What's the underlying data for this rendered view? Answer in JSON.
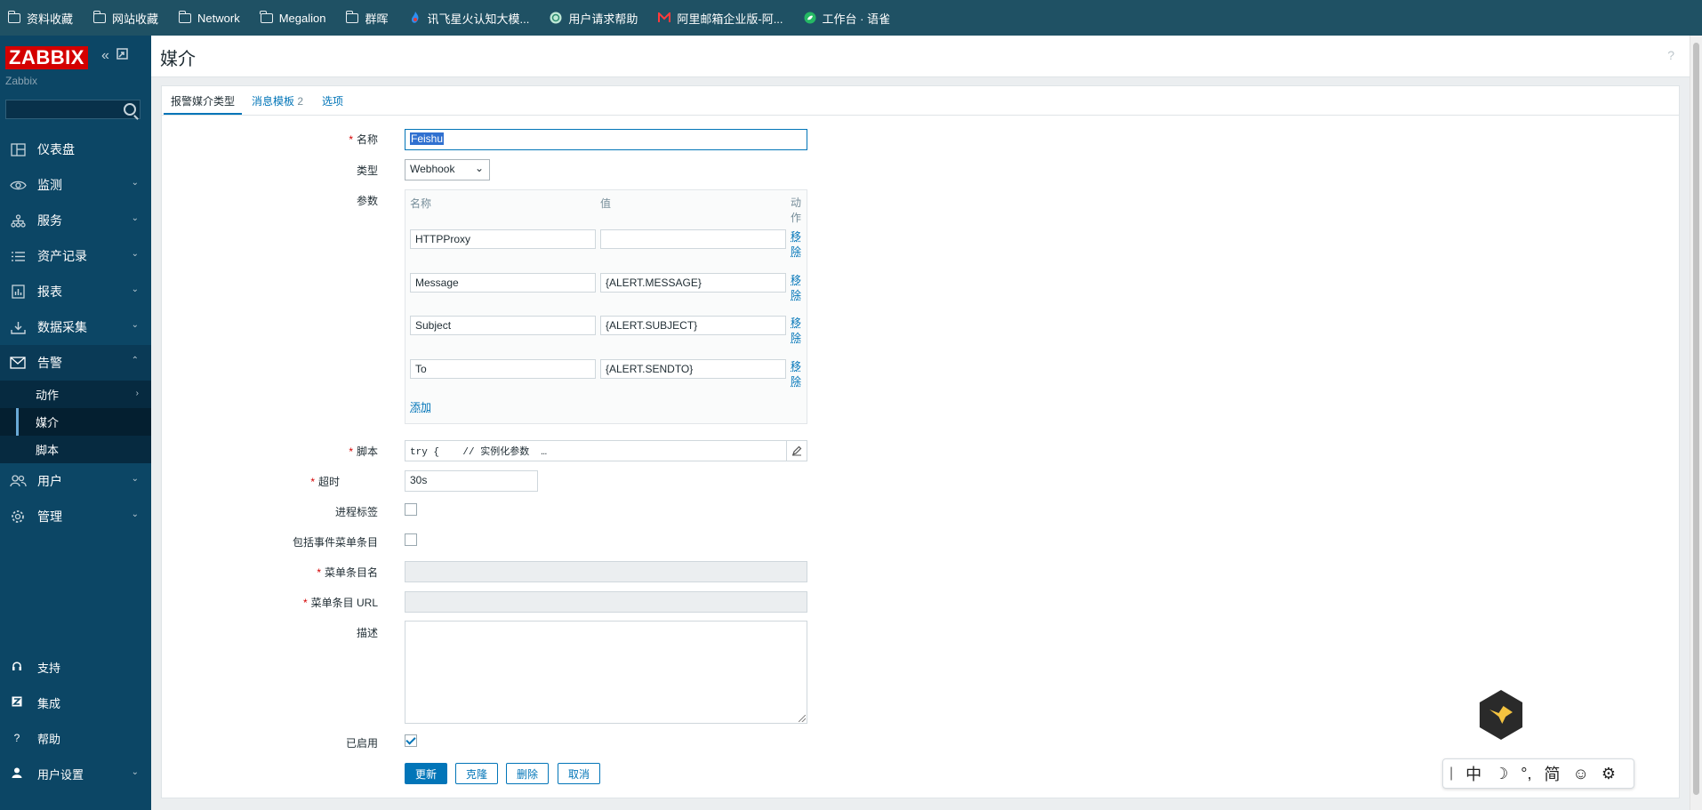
{
  "bookmarks": [
    {
      "label": "资料收藏",
      "icon": "folder-icon"
    },
    {
      "label": "网站收藏",
      "icon": "folder-icon"
    },
    {
      "label": "Network",
      "icon": "folder-icon"
    },
    {
      "label": "Megalion",
      "icon": "folder-icon"
    },
    {
      "label": "群晖",
      "icon": "folder-icon"
    },
    {
      "label": "讯飞星火认知大模...",
      "icon": "spark-logo-icon"
    },
    {
      "label": "用户请求帮助",
      "icon": "chatbot-icon"
    },
    {
      "label": "阿里邮箱企业版-阿...",
      "icon": "mail-logo-icon"
    },
    {
      "label": "工作台 · 语雀",
      "icon": "yuque-logo-icon"
    }
  ],
  "sidebar": {
    "logo": "ZABBIX",
    "server_name": "Zabbix",
    "search_placeholder": "",
    "items": [
      {
        "label": "仪表盘",
        "icon": "dashboard-icon"
      },
      {
        "label": "监测",
        "icon": "eye-icon"
      },
      {
        "label": "服务",
        "icon": "services-icon"
      },
      {
        "label": "资产记录",
        "icon": "list-icon"
      },
      {
        "label": "报表",
        "icon": "report-icon"
      },
      {
        "label": "数据采集",
        "icon": "download-icon"
      },
      {
        "label": "告警",
        "icon": "envelope-icon"
      },
      {
        "label": "用户",
        "icon": "users-icon"
      },
      {
        "label": "管理",
        "icon": "gear-icon"
      }
    ],
    "alerts_sub": [
      {
        "label": "动作"
      },
      {
        "label": "媒介"
      },
      {
        "label": "脚本"
      }
    ],
    "bottom": [
      {
        "label": "支持",
        "icon": "headset-icon"
      },
      {
        "label": "集成",
        "icon": "integrations-icon"
      },
      {
        "label": "帮助",
        "icon": "help-icon"
      },
      {
        "label": "用户设置",
        "icon": "user-icon"
      }
    ]
  },
  "header": {
    "title": "媒介",
    "help": "?"
  },
  "tabs": [
    {
      "label": "报警媒介类型"
    },
    {
      "label": "消息模板",
      "count": "2"
    },
    {
      "label": "选项"
    }
  ],
  "form": {
    "name_label": "名称",
    "name_value": "Feishu",
    "type_label": "类型",
    "type_value": "Webhook",
    "params_label": "参数",
    "params_headers": {
      "name": "名称",
      "value": "值",
      "action": "动作"
    },
    "params": [
      {
        "name": "HTTPProxy",
        "value": "",
        "remove": "移除"
      },
      {
        "name": "Message",
        "value": "{ALERT.MESSAGE}",
        "remove": "移除"
      },
      {
        "name": "Subject",
        "value": "{ALERT.SUBJECT}",
        "remove": "移除"
      },
      {
        "name": "To",
        "value": "{ALERT.SENDTO}",
        "remove": "移除"
      }
    ],
    "add_label": "添加",
    "script_label": "脚本",
    "script_value": "try {    // 实例化参数  …",
    "timeout_label": "超时",
    "timeout_value": "30s",
    "process_tags_label": "进程标签",
    "include_menu_label": "包括事件菜单条目",
    "menu_name_label": "菜单条目名",
    "menu_url_label": "菜单条目 URL",
    "description_label": "描述",
    "enabled_label": "已启用",
    "enabled": true,
    "buttons": {
      "update": "更新",
      "clone": "克隆",
      "delete": "删除",
      "cancel": "取消"
    }
  },
  "ime": {
    "mode": "中",
    "punct": "°,",
    "script": "简"
  }
}
